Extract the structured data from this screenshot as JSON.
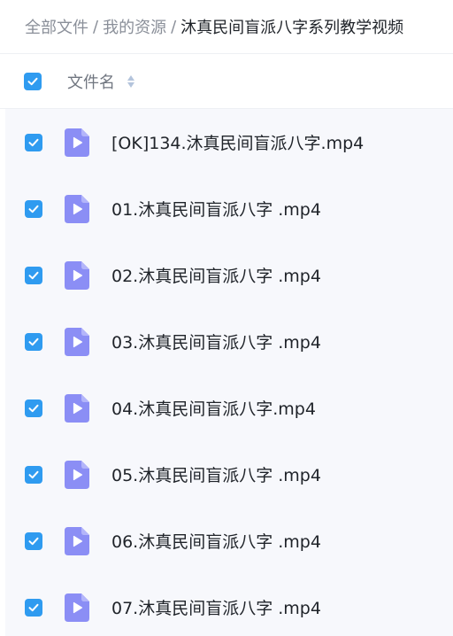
{
  "breadcrumb": {
    "items": [
      "全部文件",
      "我的资源"
    ],
    "separator": "/",
    "current": "沐真民间盲派八字系列教学视频"
  },
  "header": {
    "select_all_checked": true,
    "column_name": "文件名",
    "sort_icon": "sort-icon"
  },
  "files": [
    {
      "name": "[OK]134.沐真民间盲派八字.mp4",
      "checked": true,
      "icon": "video-file-icon"
    },
    {
      "name": "01.沐真民间盲派八字 .mp4",
      "checked": true,
      "icon": "video-file-icon"
    },
    {
      "name": "02.沐真民间盲派八字 .mp4",
      "checked": true,
      "icon": "video-file-icon"
    },
    {
      "name": "03.沐真民间盲派八字 .mp4",
      "checked": true,
      "icon": "video-file-icon"
    },
    {
      "name": "04.沐真民间盲派八字.mp4",
      "checked": true,
      "icon": "video-file-icon"
    },
    {
      "name": "05.沐真民间盲派八字 .mp4",
      "checked": true,
      "icon": "video-file-icon"
    },
    {
      "name": "06.沐真民间盲派八字 .mp4",
      "checked": true,
      "icon": "video-file-icon"
    },
    {
      "name": "07.沐真民间盲派八字 .mp4",
      "checked": true,
      "icon": "video-file-icon"
    }
  ],
  "colors": {
    "accent": "#2f9bf0",
    "file_icon": "#8b8ef5",
    "list_background": "#f7f8fc"
  }
}
